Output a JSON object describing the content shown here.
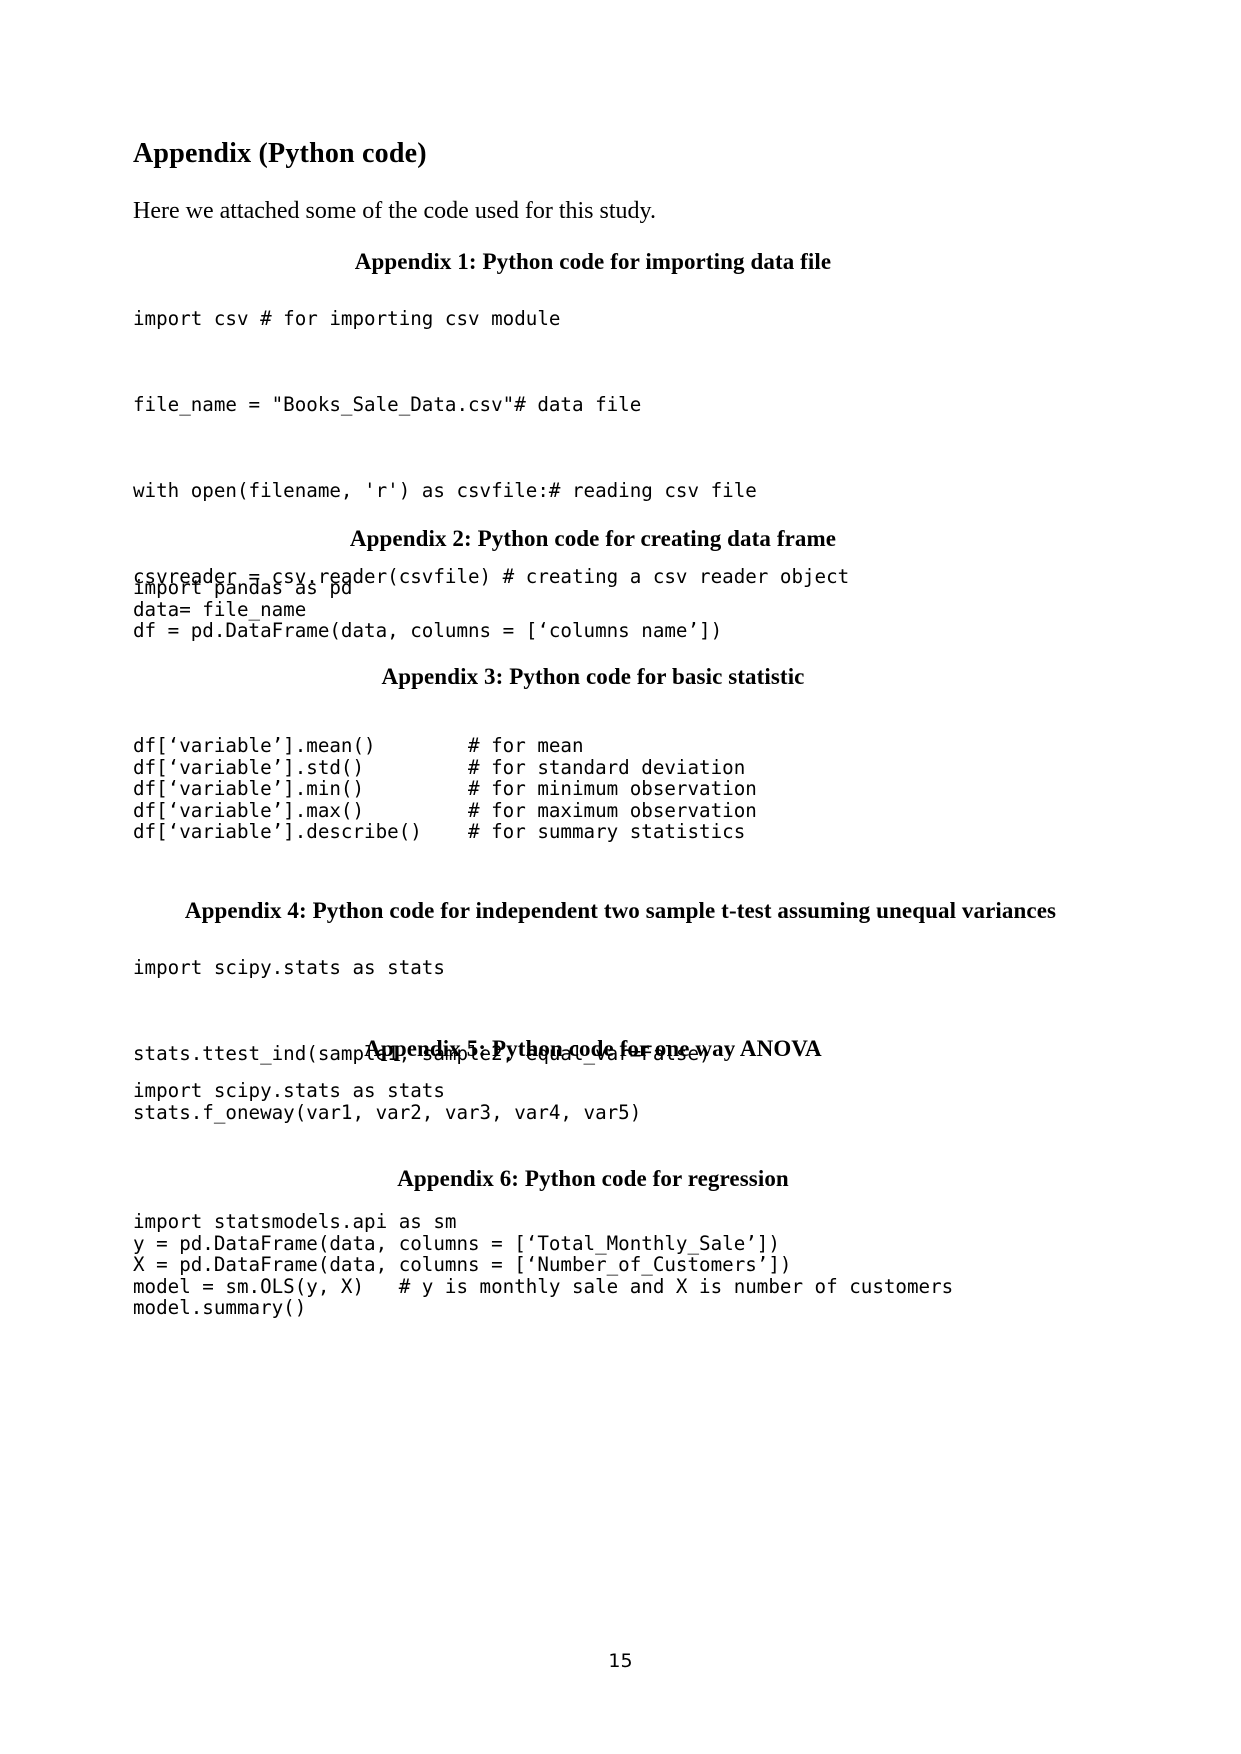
{
  "document": {
    "title": "Appendix (Python code)",
    "intro": "Here we attached some of the code used for this study.",
    "page_number": "15"
  },
  "sections": [
    {
      "heading": "Appendix 1: Python code for importing data file",
      "heading_align": "center",
      "code": "import csv # for importing csv module\n\nfile_name = \"Books_Sale_Data.csv\"# data file\n\nwith open(filename, 'r') as csvfile:# reading csv file\n\ncsvreader = csv.reader(csvfile) # creating a csv reader object",
      "code_lines": [
        "import csv # for importing csv module",
        "file_name = \"Books_Sale_Data.csv\"# data file",
        "with open(filename, 'r') as csvfile:# reading csv file",
        "csvreader = csv.reader(csvfile) # creating a csv reader object"
      ],
      "spacing": "wide"
    },
    {
      "heading": "Appendix 2: Python code for creating data frame",
      "heading_align": "center",
      "code": "import pandas as pd\ndata= file_name\ndf = pd.DataFrame(data, columns = [‘columns name’])",
      "code_lines": [
        "import pandas as pd",
        "data= file_name",
        "df = pd.DataFrame(data, columns = [‘columns name’])"
      ],
      "spacing": "tight"
    },
    {
      "heading": "Appendix 3: Python code for basic statistic",
      "heading_align": "center",
      "code": "df[‘variable’].mean()        # for mean\ndf[‘variable’].std()         # for standard deviation\ndf[‘variable’].min()         # for minimum observation\ndf[‘variable’].max()         # for maximum observation\ndf[‘variable’].describe()    # for summary statistics",
      "code_lines": [
        "df[‘variable’].mean()        # for mean",
        "df[‘variable’].std()         # for standard deviation",
        "df[‘variable’].min()         # for minimum observation",
        "df[‘variable’].max()         # for maximum observation",
        "df[‘variable’].describe()    # for summary statistics"
      ],
      "spacing": "tight"
    },
    {
      "heading": "Appendix 4: Python code for independent two sample t-test assuming unequal variances",
      "heading_align": "center",
      "code": "import scipy.stats as stats\n\nstats.ttest_ind(sample1, sample2, equal_var=False)",
      "code_lines": [
        "import scipy.stats as stats",
        "stats.ttest_ind(sample1, sample2, equal_var=False)"
      ],
      "spacing": "wide"
    },
    {
      "heading": "Appendix 5: Python code for one way ANOVA",
      "heading_align": "center",
      "code": "import scipy.stats as stats\nstats.f_oneway(var1, var2, var3, var4, var5)",
      "code_lines": [
        "import scipy.stats as stats",
        "stats.f_oneway(var1, var2, var3, var4, var5)"
      ],
      "spacing": "tight"
    },
    {
      "heading": "Appendix 6: Python code for regression",
      "heading_align": "center",
      "code": "import statsmodels.api as sm\ny = pd.DataFrame(data, columns = [‘Total_Monthly_Sale’])\nX = pd.DataFrame(data, columns = [‘Number_of_Customers’])\nmodel = sm.OLS(y, X)   # y is monthly sale and X is number of customers\nmodel.summary()",
      "code_lines": [
        "import statsmodels.api as sm",
        "y = pd.DataFrame(data, columns = [‘Total_Monthly_Sale’])",
        "X = pd.DataFrame(data, columns = [‘Number_of_Customers’])",
        "model = sm.OLS(y, X)   # y is monthly sale and X is number of customers",
        "model.summary()"
      ],
      "spacing": "tight"
    }
  ]
}
